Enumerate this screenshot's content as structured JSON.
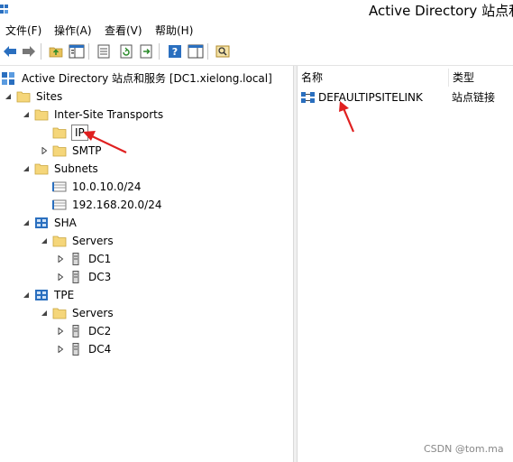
{
  "window": {
    "title": "Active Directory 站点和"
  },
  "menu": {
    "file": "文件(F)",
    "action": "操作(A)",
    "view": "查看(V)",
    "help": "帮助(H)"
  },
  "tree": {
    "root": "Active Directory 站点和服务 [DC1.xielong.local]",
    "sites": "Sites",
    "inter_site": "Inter-Site Transports",
    "ip": "IP",
    "smtp": "SMTP",
    "subnets": "Subnets",
    "subnet1": "10.0.10.0/24",
    "subnet2": "192.168.20.0/24",
    "sha": "SHA",
    "sha_servers": "Servers",
    "dc1": "DC1",
    "dc3": "DC3",
    "tpe": "TPE",
    "tpe_servers": "Servers",
    "dc2": "DC2",
    "dc4": "DC4"
  },
  "list": {
    "col_name": "名称",
    "col_type": "类型",
    "rows": [
      {
        "name": "DEFAULTIPSITELINK",
        "type": "站点链接"
      }
    ]
  },
  "watermark": "CSDN @tom.ma",
  "colors": {
    "folder": "#e8c25a",
    "accent_blue": "#2a6fbf",
    "arrow_red": "#e02020"
  }
}
